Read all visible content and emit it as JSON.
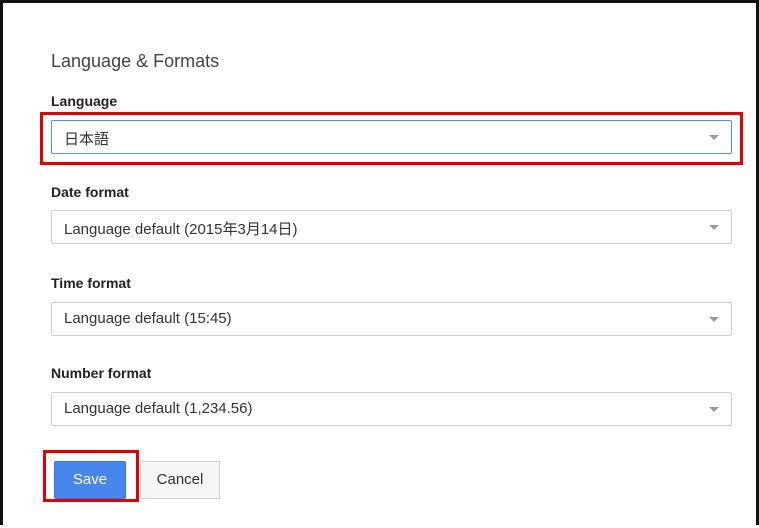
{
  "panel": {
    "title": "Language & Formats"
  },
  "fields": [
    {
      "label": "Language",
      "value": "日本語"
    },
    {
      "label": "Date format",
      "value": "Language default (2015年3月14日)"
    },
    {
      "label": "Time format",
      "value": "Language default (15:45)"
    },
    {
      "label": "Number format",
      "value": "Language default (1,234.56)"
    }
  ],
  "actions": {
    "save_label": "Save",
    "cancel_label": "Cancel"
  },
  "colors": {
    "highlight": "#e00000",
    "save_button": "#4787ed",
    "focus_border": "#4d90fe"
  },
  "icons": {
    "dropdown": "chevron-down-icon"
  }
}
